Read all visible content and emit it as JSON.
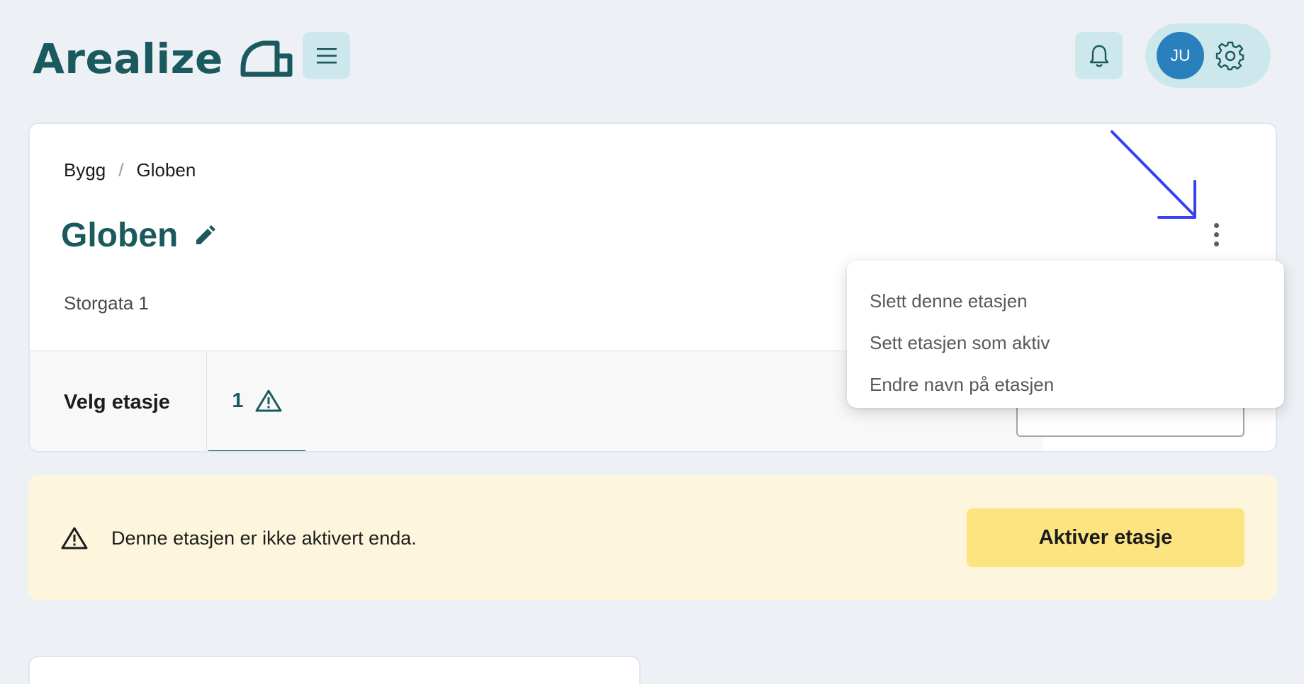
{
  "app": {
    "name": "Arealize"
  },
  "header": {
    "menu_icon": "hamburger-icon",
    "bell_icon": "bell-icon",
    "user_initials": "JU",
    "settings_icon": "gear-icon"
  },
  "breadcrumb": {
    "items": [
      "Bygg",
      "Globen"
    ],
    "separator": "/"
  },
  "page": {
    "title": "Globen",
    "edit_icon": "pencil-icon",
    "address": "Storgata 1"
  },
  "floor_tabs": {
    "label": "Velg etasje",
    "tabs": [
      {
        "label": "1",
        "icon": "warning-icon"
      }
    ]
  },
  "menu": {
    "items": [
      "Slett denne etasjen",
      "Sett etasjen som aktiv",
      "Endre navn på etasjen"
    ]
  },
  "banner": {
    "message": "Denne etasjen er ikke aktivert enda.",
    "button_label": "Aktiver etasje"
  },
  "colors": {
    "brand": "#1a5a5e",
    "accent_light": "#cde8ec",
    "avatar": "#2a7fbd",
    "banner_bg": "#fdf6dc",
    "button_yellow": "#fce480",
    "annotation_arrow": "#3a3ff0"
  }
}
